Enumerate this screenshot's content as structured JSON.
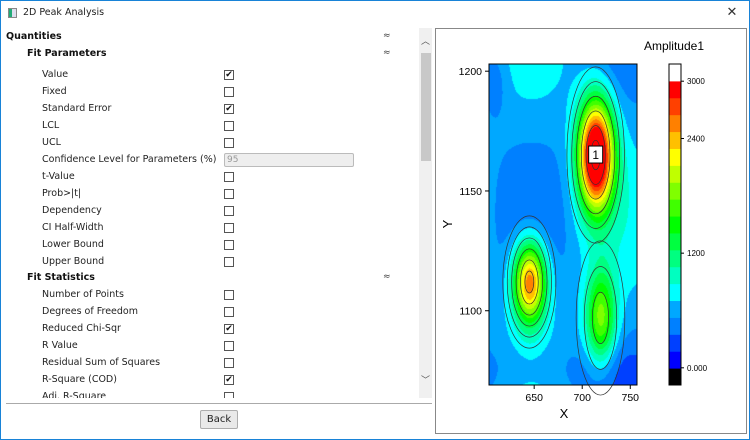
{
  "window": {
    "title": "2D Peak Analysis",
    "close_icon": "close-icon"
  },
  "tree": {
    "quantities": "Quantities",
    "fit_parameters": {
      "label": "Fit Parameters",
      "items": [
        {
          "label": "Value",
          "checked": true
        },
        {
          "label": "Fixed",
          "checked": false
        },
        {
          "label": "Standard Error",
          "checked": true
        },
        {
          "label": "LCL",
          "checked": false
        },
        {
          "label": "UCL",
          "checked": false
        },
        {
          "label": "Confidence Level for Parameters (%)",
          "value": "95"
        },
        {
          "label": "t-Value",
          "checked": false
        },
        {
          "label": "Prob>|t|",
          "checked": false
        },
        {
          "label": "Dependency",
          "checked": false
        },
        {
          "label": "CI Half-Width",
          "checked": false
        },
        {
          "label": "Lower Bound",
          "checked": false
        },
        {
          "label": "Upper Bound",
          "checked": false
        }
      ]
    },
    "fit_statistics": {
      "label": "Fit Statistics",
      "items": [
        {
          "label": "Number of Points",
          "checked": false
        },
        {
          "label": "Degrees of Freedom",
          "checked": false
        },
        {
          "label": "Reduced Chi-Sqr",
          "checked": true
        },
        {
          "label": "R Value",
          "checked": false
        },
        {
          "label": "Residual Sum of Squares",
          "checked": false
        },
        {
          "label": "R-Square (COD)",
          "checked": true
        },
        {
          "label": "Adj. R-Square",
          "checked": false
        }
      ]
    }
  },
  "buttons": {
    "back": "Back"
  },
  "chart_data": {
    "type": "heatmap",
    "subtype": "contour",
    "xlabel": "X",
    "ylabel": "Y",
    "xlim": [
      603,
      757
    ],
    "ylim": [
      1069,
      1203
    ],
    "xticks": [
      "650",
      "700",
      "750"
    ],
    "yticks": [
      "1100",
      "1150",
      "1200"
    ],
    "colorbar": {
      "title": "Amplitude1",
      "ticks": [
        "0.000",
        "1200",
        "2400",
        "3000"
      ],
      "range": [
        -180,
        3180
      ],
      "colors": [
        "#000000",
        "#0000ff",
        "#0040ff",
        "#0080ff",
        "#00a8ff",
        "#00ffff",
        "#00ffc0",
        "#00ff80",
        "#00ff40",
        "#00ff00",
        "#40ff00",
        "#80ff00",
        "#c0ff00",
        "#ffff00",
        "#ffc000",
        "#ff8000",
        "#ff4000",
        "#ff0000",
        "#ffffff"
      ]
    },
    "peaks": [
      {
        "label": "1",
        "x": 714,
        "y": 1165,
        "amplitude": 2950,
        "width_x": 13,
        "width_y": 16
      },
      {
        "x": 645,
        "y": 1112,
        "amplitude": 2100,
        "width_x": 12,
        "width_y": 12
      },
      {
        "x": 719,
        "y": 1097,
        "amplitude": 1250,
        "width_x": 11,
        "width_y": 14
      }
    ],
    "baseline": 600,
    "peak_marker": "1"
  }
}
